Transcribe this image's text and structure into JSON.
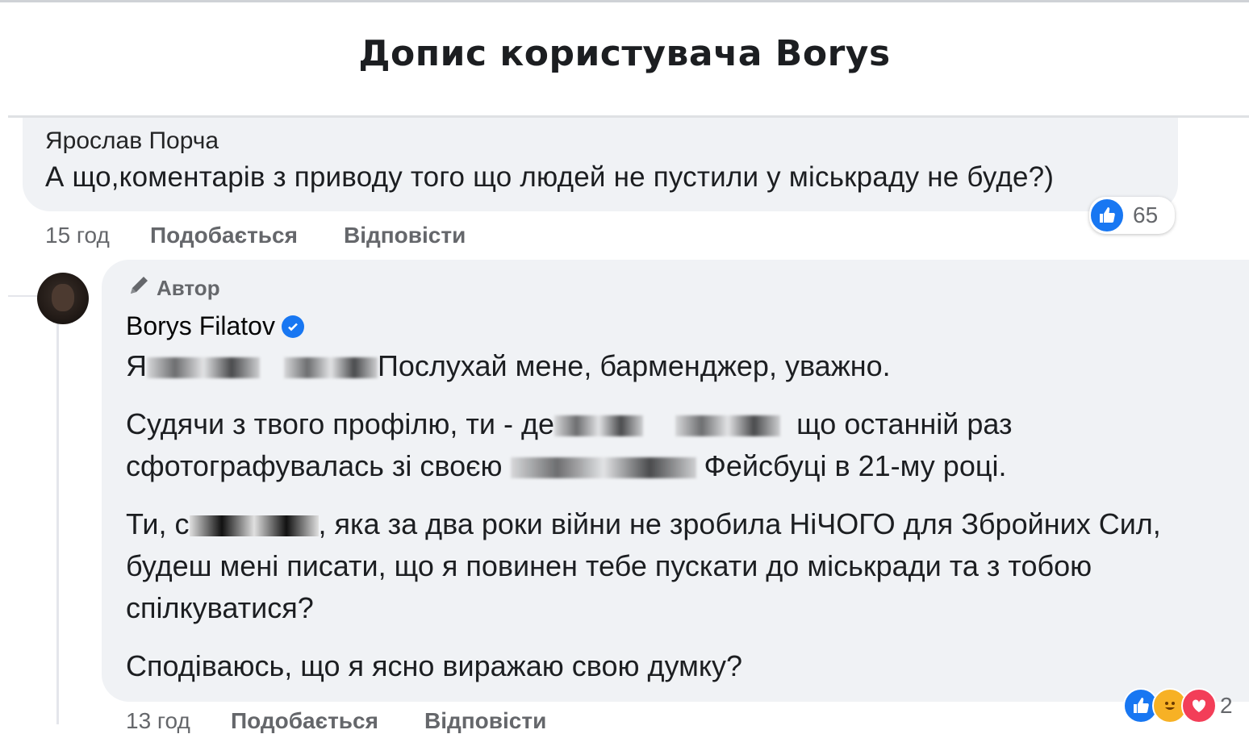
{
  "header": {
    "title": "Допис користувача Borys"
  },
  "comment1": {
    "author": "Ярослав Порча",
    "text": "А що,коментарів з приводу того що людей не пустили у міськраду не буде?)",
    "time": "15 год",
    "like_label": "Подобається",
    "reply_label": "Відповісти",
    "reaction_count": "65",
    "reaction_icons": [
      "like-icon"
    ]
  },
  "comment2": {
    "badge": "Автор",
    "author": "Borys Filatov",
    "verified": true,
    "para1": {
      "prefix": "Я",
      "text": "Послухай мене, барменджер, уважно."
    },
    "para2": {
      "line1_a": "Судячи з твого профілю, ти - де",
      "line1_b": "що останній раз",
      "line2_a": "сфотографувалась зі своєю",
      "line2_b": "Фейсбуці в 21-му році."
    },
    "para3": {
      "line1_a": "Ти, с",
      "line1_b": ", яка за два роки війни не зробила НіЧОГО для Збройних Сил,",
      "line2": "будеш мені писати, що я повинен тебе пускати до міськради та з тобою",
      "line3": "спілкуватися?"
    },
    "para4": "Сподіваюсь, що я ясно виражаю свою думку?",
    "time": "13 год",
    "like_label": "Подобається",
    "reply_label": "Відповісти",
    "reaction_count": "2",
    "reaction_icons": [
      "like-icon",
      "haha-icon",
      "love-icon"
    ]
  },
  "colors": {
    "bubble": "#f0f2f5",
    "like": "#1877f2",
    "meta": "#65676b"
  }
}
